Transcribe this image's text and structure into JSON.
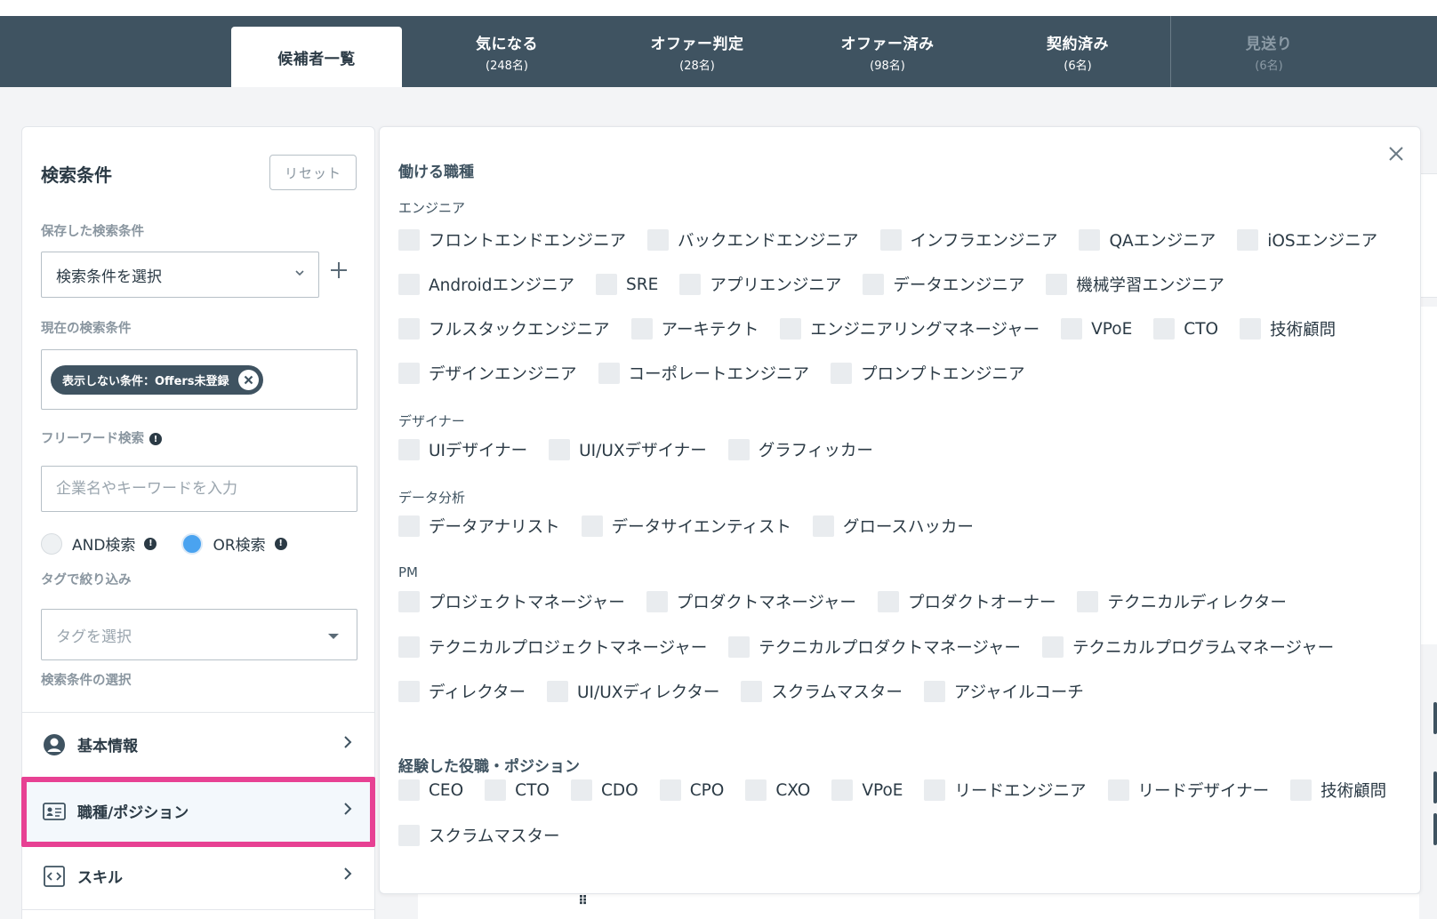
{
  "tabs": [
    {
      "label": "候補者一覧",
      "count": ""
    },
    {
      "label": "気になる",
      "count": "(248名)"
    },
    {
      "label": "オファー判定",
      "count": "(28名)"
    },
    {
      "label": "オファー済み",
      "count": "(98名)"
    },
    {
      "label": "契約済み",
      "count": "(6名)"
    },
    {
      "label": "見送り",
      "count": "(6名)"
    }
  ],
  "sidebar": {
    "title": "検索条件",
    "reset_label": "リセット",
    "saved_label": "保存した検索条件",
    "saved_select_value": "検索条件を選択",
    "current_label": "現在の検索条件",
    "chip_label": "表示しない条件：Offers未登録",
    "freeword_label": "フリーワード検索",
    "freeword_placeholder": "企業名やキーワードを入力",
    "and_label": "AND検索",
    "or_label": "OR検索",
    "tag_label": "タグで絞り込み",
    "tag_placeholder": "タグを選択",
    "selection_label": "検索条件の選択",
    "menu": [
      {
        "label": "基本情報"
      },
      {
        "label": "職種/ポジション"
      },
      {
        "label": "スキル"
      }
    ]
  },
  "panel": {
    "title_jobs": "働ける職種",
    "groups": [
      {
        "name": "エンジニア",
        "rows": [
          [
            "フロントエンドエンジニア",
            "バックエンドエンジニア",
            "インフラエンジニア",
            "QAエンジニア",
            "iOSエンジニア"
          ],
          [
            "Androidエンジニア",
            "SRE",
            "アプリエンジニア",
            "データエンジニア",
            "機械学習エンジニア"
          ],
          [
            "フルスタックエンジニア",
            "アーキテクト",
            "エンジニアリングマネージャー",
            "VPoE",
            "CTO",
            "技術顧問"
          ],
          [
            "デザインエンジニア",
            "コーポレートエンジニア",
            "プロンプトエンジニア"
          ]
        ]
      },
      {
        "name": "デザイナー",
        "rows": [
          [
            "UIデザイナー",
            "UI/UXデザイナー",
            "グラフィッカー"
          ]
        ]
      },
      {
        "name": "データ分析",
        "rows": [
          [
            "データアナリスト",
            "データサイエンティスト",
            "グロースハッカー"
          ]
        ]
      },
      {
        "name": "PM",
        "rows": [
          [
            "プロジェクトマネージャー",
            "プロダクトマネージャー",
            "プロダクトオーナー",
            "テクニカルディレクター"
          ],
          [
            "テクニカルプロジェクトマネージャー",
            "テクニカルプロダクトマネージャー",
            "テクニカルプログラムマネージャー"
          ],
          [
            "ディレクター",
            "UI/UXディレクター",
            "スクラムマスター",
            "アジャイルコーチ"
          ]
        ]
      }
    ],
    "title_positions": "経験した役職・ポジション",
    "position_rows": [
      [
        "CEO",
        "CTO",
        "CDO",
        "CPO",
        "CXO",
        "VPoE",
        "リードエンジニア",
        "リードデザイナー",
        "技術顧問"
      ],
      [
        "スクラムマスター"
      ]
    ]
  },
  "icons": {
    "close": "close-icon",
    "plus": "plus-icon",
    "chevron_down": "chevron-down-icon",
    "chevron_right": "chevron-right-icon"
  },
  "colors": {
    "tabbar": "#3f5361",
    "highlight": "#e74193",
    "radio_on": "#4aa3f0"
  }
}
